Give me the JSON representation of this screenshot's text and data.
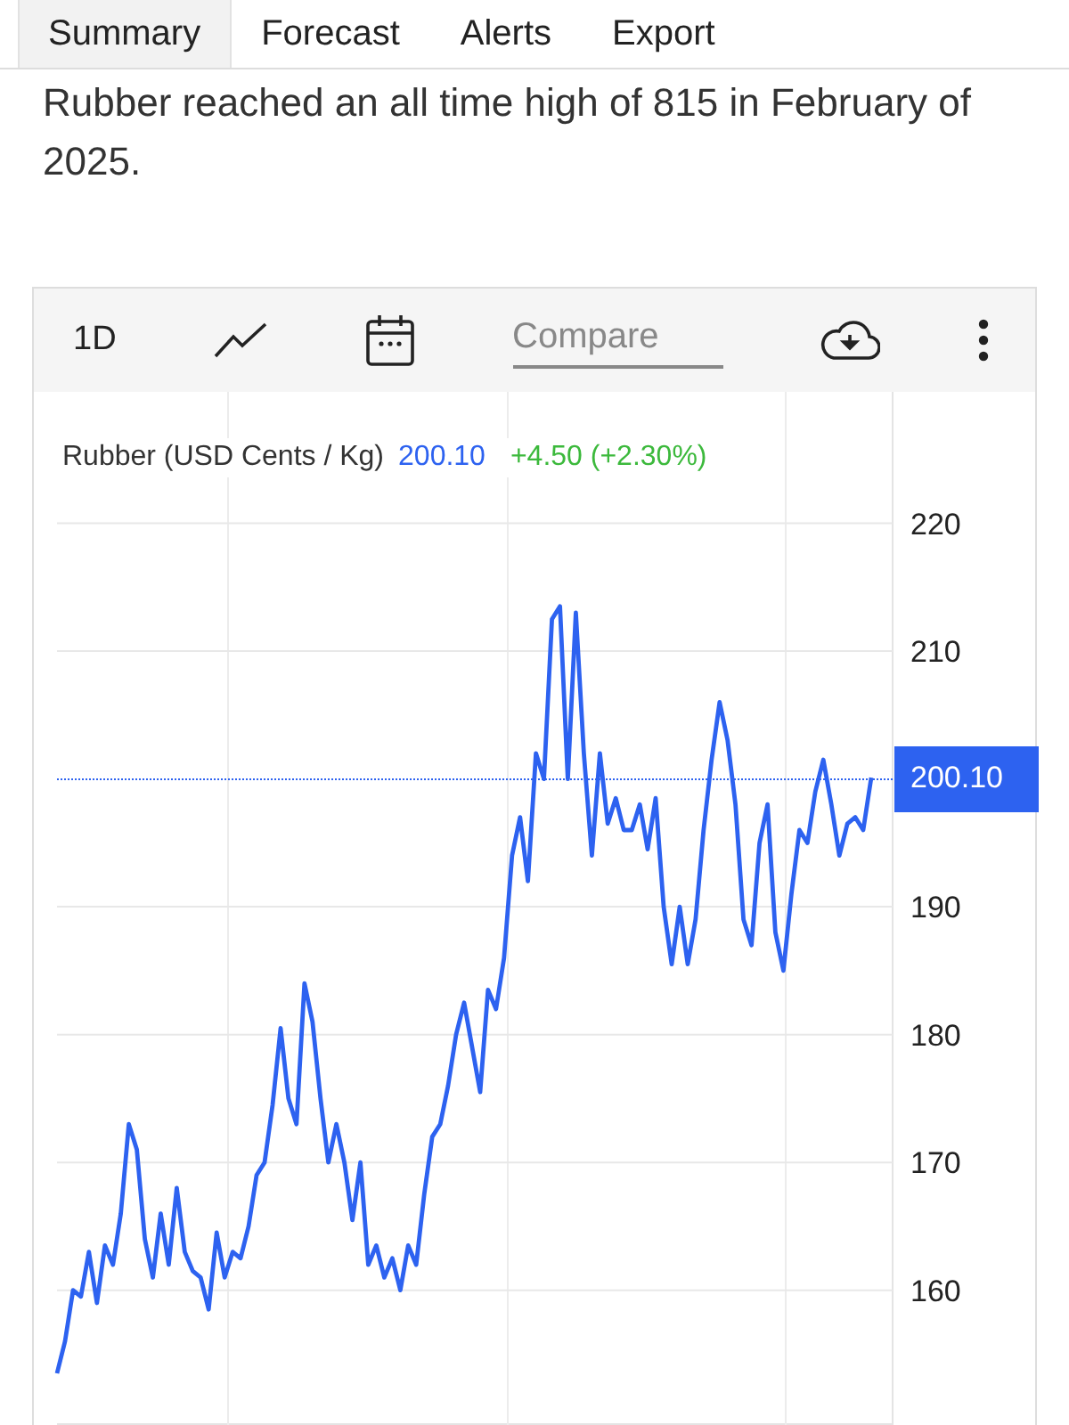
{
  "tabs": [
    {
      "label": "Summary",
      "selected": true
    },
    {
      "label": "Forecast",
      "selected": false
    },
    {
      "label": "Alerts",
      "selected": false
    },
    {
      "label": "Export",
      "selected": false
    }
  ],
  "summary_text": "Rubber reached an all time high of 815 in February of 2025.",
  "chart_toolbar": {
    "interval": "1D",
    "compare": {
      "placeholder": "Compare"
    }
  },
  "legend": {
    "price": "200.10",
    "change": "+4.50 (+2.30%)"
  },
  "price_tag": "200.10",
  "chart_data": {
    "type": "line",
    "ylim": [
      148.9,
      230
    ],
    "yticks": [
      160,
      170,
      180,
      190,
      210,
      220
    ],
    "grid": true,
    "series": [
      {
        "name": "Rubber (USD Cents / Kg)",
        "color": "#2d62f0",
        "values": [
          153.5,
          156,
          160,
          159.5,
          163,
          159,
          163.5,
          162,
          166,
          173,
          171,
          164,
          161,
          166,
          162,
          168,
          163,
          161.5,
          161,
          158.5,
          164.5,
          161,
          163,
          162.5,
          165,
          169,
          170,
          174.5,
          180.5,
          175,
          173,
          184,
          181,
          175,
          170,
          173,
          170,
          165.5,
          170,
          162,
          163.5,
          161,
          162.5,
          160,
          163.5,
          162,
          167.5,
          172,
          173,
          176,
          180,
          182.5,
          179,
          175.5,
          183.5,
          182,
          186,
          194,
          197,
          192,
          202,
          200,
          212.5,
          213.5,
          200,
          213,
          202,
          194,
          202,
          196.5,
          198.5,
          196,
          196,
          198,
          194.5,
          198.5,
          190,
          185.5,
          190,
          185.5,
          189,
          196,
          201.5,
          206,
          203,
          198,
          189,
          187,
          195,
          198,
          188,
          185,
          191,
          196,
          195,
          199,
          201.5,
          198,
          194,
          196.5,
          197,
          196,
          200.1
        ]
      }
    ]
  }
}
